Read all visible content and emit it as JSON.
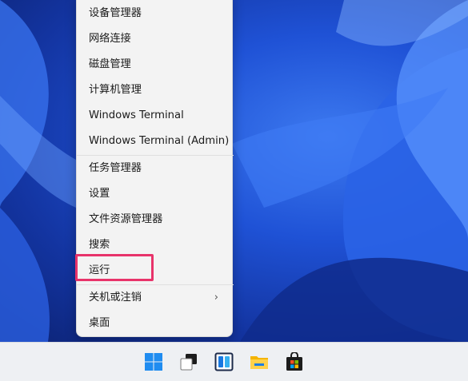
{
  "context_menu": {
    "items": [
      {
        "label": "设备管理器"
      },
      {
        "label": "网络连接"
      },
      {
        "label": "磁盘管理"
      },
      {
        "label": "计算机管理"
      },
      {
        "label": "Windows Terminal"
      },
      {
        "label": "Windows Terminal (Admin)"
      },
      {
        "label": "任务管理器"
      },
      {
        "label": "设置"
      },
      {
        "label": "文件资源管理器"
      },
      {
        "label": "搜索"
      },
      {
        "label": "运行"
      },
      {
        "label": "关机或注销"
      },
      {
        "label": "桌面"
      }
    ],
    "submenu_chevron": "›"
  },
  "taskbar": {
    "icons": [
      "windows-start-icon",
      "task-view-icon",
      "widgets-icon",
      "file-explorer-icon",
      "microsoft-store-icon"
    ]
  },
  "colors": {
    "highlight": "#e8336a",
    "menu_bg": "#f3f3f3",
    "taskbar_bg": "#eef0f3"
  }
}
